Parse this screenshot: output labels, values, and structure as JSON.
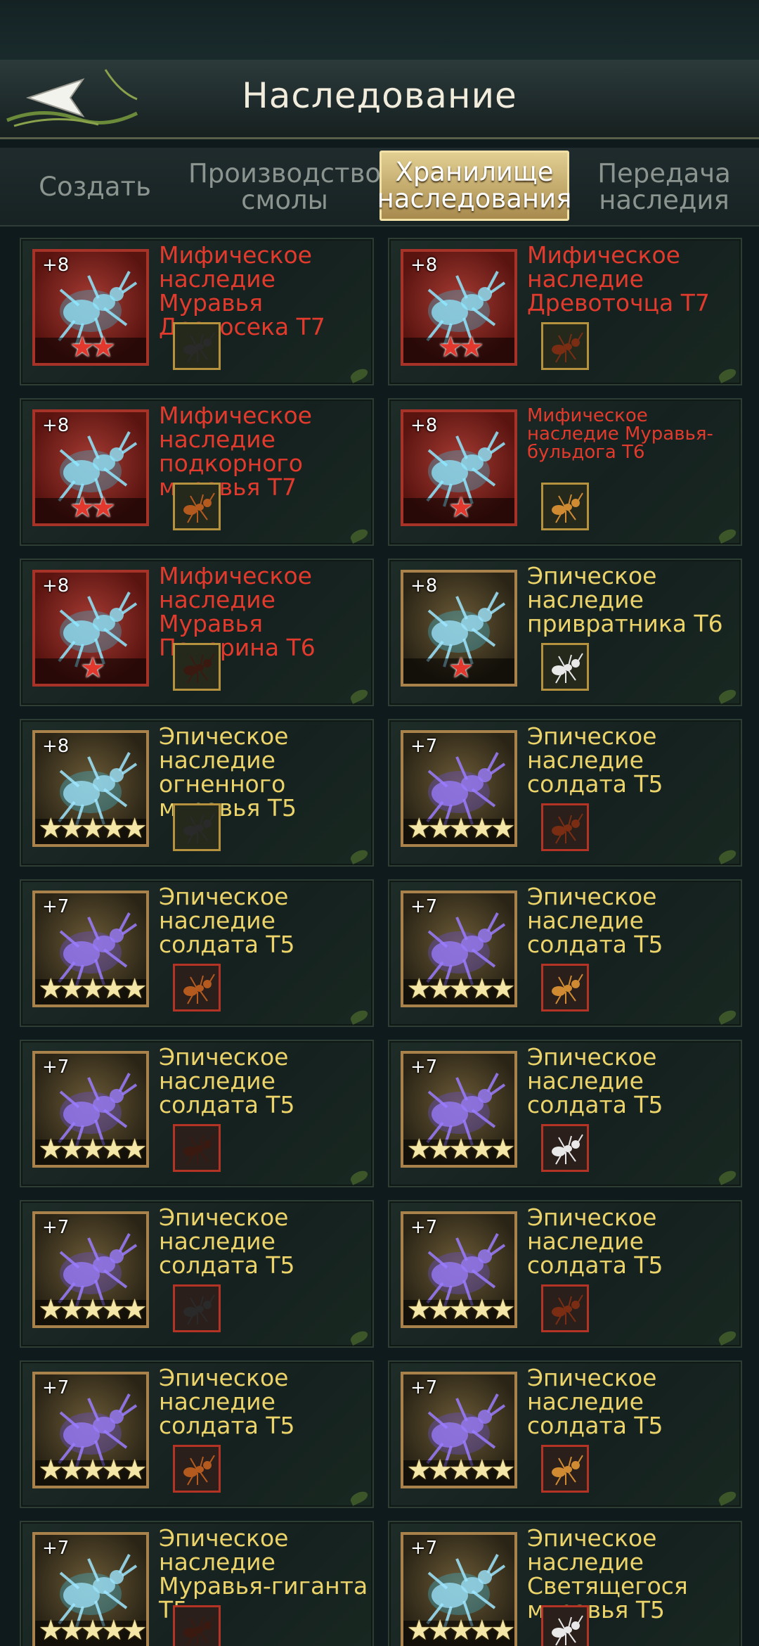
{
  "header": {
    "title": "Наследование",
    "back_icon": "back-arrow-icon"
  },
  "tabs": [
    {
      "label": "Создать",
      "active": false
    },
    {
      "label": "Производство смолы",
      "active": false
    },
    {
      "label": "Хранилище наследования",
      "active": true
    },
    {
      "label": "Передача наследия",
      "active": false
    }
  ],
  "colors": {
    "mythic": "#e23a2c",
    "epic": "#ecd36a",
    "active_tab": "#d6bf7e"
  },
  "cards": [
    {
      "level": "+8",
      "title": "Мифическое наследие Муравья Дровосека Т7",
      "rarity": "mythic",
      "stars": "★★",
      "star_color": "red",
      "thumb": "black-ant-icon"
    },
    {
      "level": "+8",
      "title": "Мифическое наследие Древоточца Т7",
      "rarity": "mythic",
      "stars": "★★",
      "star_color": "red",
      "thumb": "woodborer-ant-icon"
    },
    {
      "level": "+8",
      "title": "Мифическое наследие подкорного муравья Т7",
      "rarity": "mythic",
      "stars": "★★",
      "star_color": "red",
      "thumb": "bark-ant-icon"
    },
    {
      "level": "+8",
      "title": "Мифическое наследие Муравья-бульдога Т6",
      "rarity": "mythic",
      "stars": "★",
      "star_color": "red",
      "thumb": "bulldog-ant-icon"
    },
    {
      "level": "+8",
      "title": "Мифическое наследие Муравья Понерина Т6",
      "rarity": "mythic",
      "stars": "★",
      "star_color": "red",
      "thumb": "ponerine-ant-icon"
    },
    {
      "level": "+8",
      "title": "Эпическое наследие привратника Т6",
      "rarity": "epic",
      "stars": "★",
      "star_color": "red",
      "thumb": "doorkeeper-ant-icon"
    },
    {
      "level": "+8",
      "title": "Эпическое наследие огненного муравья Т5",
      "rarity": "epic",
      "stars": "★★★★★",
      "star_color": "gold",
      "thumb": "fire-ant-icon"
    },
    {
      "level": "+7",
      "title": "Эпическое наследие солдата Т5",
      "rarity": "epic",
      "stars": "★★★★★",
      "star_color": "gold",
      "thumb": "soldier-ant-icon"
    },
    {
      "level": "+7",
      "title": "Эпическое наследие солдата Т5",
      "rarity": "epic",
      "stars": "★★★★★",
      "star_color": "gold",
      "thumb": "soldier-ant-icon"
    },
    {
      "level": "+7",
      "title": "Эпическое наследие солдата Т5",
      "rarity": "epic",
      "stars": "★★★★★",
      "star_color": "gold",
      "thumb": "soldier-ant-icon"
    },
    {
      "level": "+7",
      "title": "Эпическое наследие солдата Т5",
      "rarity": "epic",
      "stars": "★★★★★",
      "star_color": "gold",
      "thumb": "soldier-ant-icon"
    },
    {
      "level": "+7",
      "title": "Эпическое наследие солдата Т5",
      "rarity": "epic",
      "stars": "★★★★★",
      "star_color": "gold",
      "thumb": "white-ant-icon"
    },
    {
      "level": "+7",
      "title": "Эпическое наследие солдата Т5",
      "rarity": "epic",
      "stars": "★★★★★",
      "star_color": "gold",
      "thumb": "soldier-ant-icon"
    },
    {
      "level": "+7",
      "title": "Эпическое наследие солдата Т5",
      "rarity": "epic",
      "stars": "★★★★★",
      "star_color": "gold",
      "thumb": "soldier-ant-icon"
    },
    {
      "level": "+7",
      "title": "Эпическое наследие солдата Т5",
      "rarity": "epic",
      "stars": "★★★★★",
      "star_color": "gold",
      "thumb": "soldier-ant-icon"
    },
    {
      "level": "+7",
      "title": "Эпическое наследие солдата Т5",
      "rarity": "epic",
      "stars": "★★★★★",
      "star_color": "gold",
      "thumb": "soldier-ant-icon"
    },
    {
      "level": "+7",
      "title": "Эпическое наследие Муравья-гиганта Т5",
      "rarity": "epic",
      "stars": "★★★★★",
      "star_color": "gold",
      "thumb": "giant-ant-icon"
    },
    {
      "level": "+7",
      "title": "Эпическое наследие Светящегося муравья Т5",
      "rarity": "epic",
      "stars": "★★★★★",
      "star_color": "gold",
      "thumb": "glowing-ant-icon"
    }
  ]
}
